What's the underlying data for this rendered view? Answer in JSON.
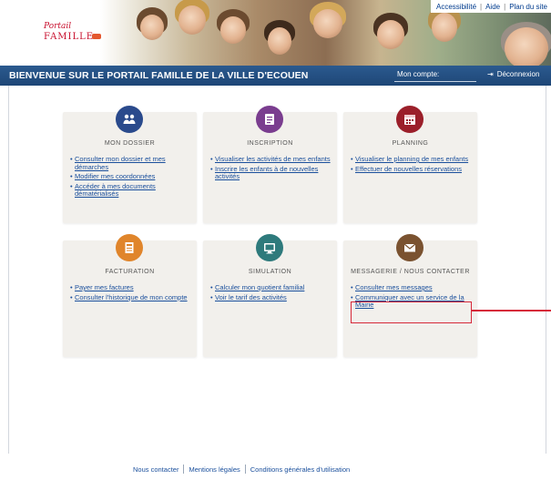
{
  "header": {
    "logo_small": "Portail",
    "logo_big": "FAMILLE",
    "toplinks": {
      "accessibility": "Accessibilité",
      "help": "Aide",
      "sitemap": "Plan du site"
    }
  },
  "bar": {
    "title": "BIENVENUE SUR LE PORTAIL FAMILLE DE LA VILLE D'ECOUEN",
    "account_label": "Mon compte:",
    "logout_icon": "logout-icon",
    "logout": "Déconnexion"
  },
  "colors": {
    "bar": "#1e4676",
    "card": "#f2f0ec",
    "link": "#1a4f9c",
    "highlight": "#d62839",
    "icon_dossier": "#2a4a8c",
    "icon_inscription": "#7a3d8f",
    "icon_planning": "#9b1f2a",
    "icon_facturation": "#e0852b",
    "icon_simulation": "#2e7a7c",
    "icon_messagerie": "#7a5230"
  },
  "cards": [
    {
      "title": "Mon dossier",
      "icon": "family-icon",
      "links": [
        "Consulter mon dossier et mes démarches",
        "Modifier mes coordonnées",
        "Accéder à mes documents dématérialisés"
      ]
    },
    {
      "title": "Inscription",
      "icon": "edit-document-icon",
      "links": [
        "Visualiser les activités de mes enfants",
        "Inscrire les enfants à de nouvelles activités"
      ]
    },
    {
      "title": "Planning",
      "icon": "calendar-icon",
      "links": [
        "Visualiser le planning de mes enfants",
        "Effectuer de nouvelles réservations"
      ]
    },
    {
      "title": "Facturation",
      "icon": "invoice-icon",
      "links": [
        "Payer mes factures",
        "Consulter l'historique de mon compte"
      ]
    },
    {
      "title": "Simulation",
      "icon": "calculator-screen-icon",
      "links": [
        "Calculer mon quotient familial",
        "Voir le tarif des activités"
      ]
    },
    {
      "title": "Messagerie / nous contacter",
      "icon": "envelope-icon",
      "links": [
        "Consulter mes messages",
        "Communiquer avec un service de la Mairie"
      ]
    }
  ],
  "footer": {
    "contact": "Nous contacter",
    "legal": "Mentions légales",
    "terms": "Conditions générales d'utilisation"
  }
}
